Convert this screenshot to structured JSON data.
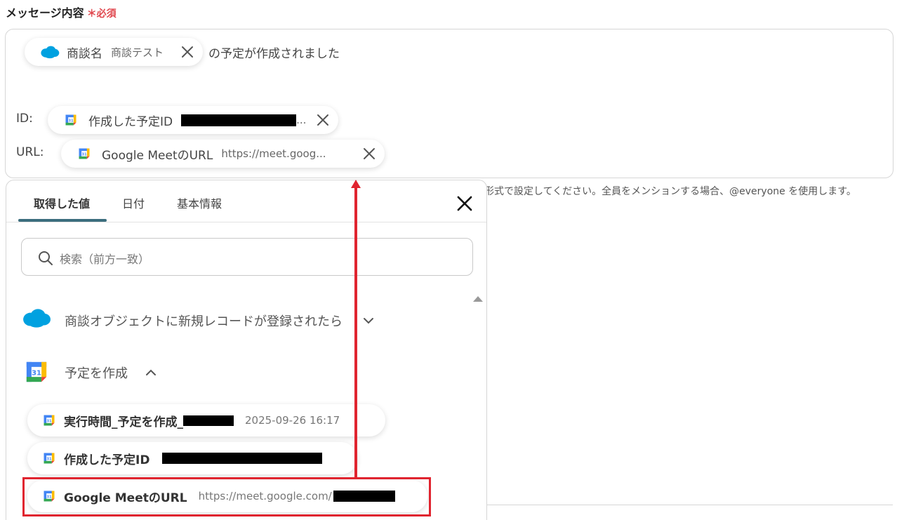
{
  "field": {
    "label": "メッセージ内容",
    "required": "＊必須"
  },
  "editor": {
    "line1_suffix": "の予定が作成されました",
    "id_label": "ID:",
    "url_label": "URL:",
    "pills": [
      {
        "icon": "salesforce-icon",
        "label": "商談名",
        "value": "商談テスト"
      },
      {
        "icon": "google-calendar-icon",
        "label": "作成した予定ID",
        "value": "..."
      },
      {
        "icon": "google-calendar-icon",
        "label": "Google MeetのURL",
        "value": "https://meet.goog..."
      }
    ]
  },
  "help_text": "形式で設定してください。全員をメンションする場合、@everyone を使用します。",
  "panel": {
    "tabs": [
      "取得した値",
      "日付",
      "基本情報"
    ],
    "search_placeholder": "検索（前方一致）",
    "groups": [
      {
        "icon": "salesforce-icon",
        "label": "商談オブジェクトに新規レコードが登録されたら",
        "state": "collapsed"
      },
      {
        "icon": "google-calendar-icon",
        "label": "予定を作成",
        "state": "expanded"
      }
    ],
    "items": [
      {
        "label": "実行時間_予定を作成_",
        "value": "2025-09-26 16:17"
      },
      {
        "label": "作成した予定ID",
        "value": ""
      },
      {
        "label": "Google MeetのURL",
        "value": "https://meet.google.com/"
      }
    ]
  },
  "colors": {
    "accent": "#3c6e7e",
    "annotation": "#e0242f",
    "required": "#e0474e"
  }
}
